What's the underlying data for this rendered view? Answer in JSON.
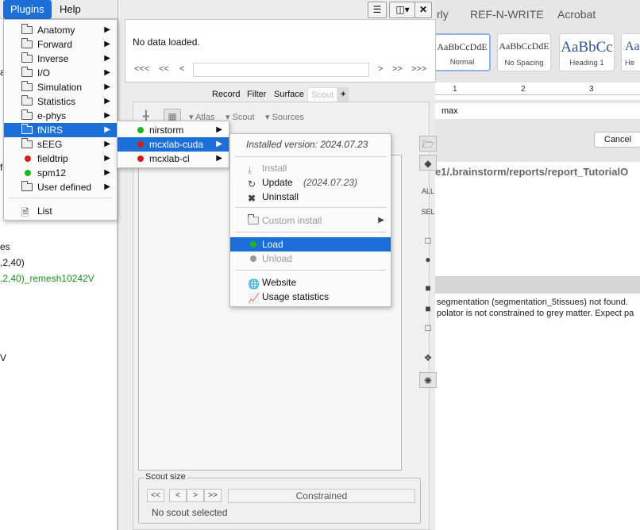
{
  "menubar": {
    "items": [
      {
        "label": "Plugins",
        "active": true
      },
      {
        "label": "Help",
        "active": false
      }
    ]
  },
  "plugins_menu": {
    "items": [
      {
        "label": "Anatomy",
        "submenu": true
      },
      {
        "label": "Forward",
        "submenu": true
      },
      {
        "label": "Inverse",
        "submenu": true
      },
      {
        "label": "I/O",
        "submenu": true
      },
      {
        "label": "Simulation",
        "submenu": true
      },
      {
        "label": "Statistics",
        "submenu": true
      },
      {
        "label": "e-phys",
        "submenu": true
      },
      {
        "label": "fNIRS",
        "submenu": true,
        "highlighted": true
      },
      {
        "label": "sEEG",
        "submenu": true
      },
      {
        "label": "fieldtrip",
        "submenu": true,
        "status": "red"
      },
      {
        "label": "spm12",
        "submenu": true,
        "status": "green"
      },
      {
        "label": "User defined",
        "submenu": true
      }
    ],
    "list_label": "List"
  },
  "fnirs_menu": {
    "items": [
      {
        "label": "nirstorm",
        "status": "green"
      },
      {
        "label": "mcxlab-cuda",
        "status": "red",
        "highlighted": true
      },
      {
        "label": "mcxlab-cl",
        "status": "red"
      }
    ]
  },
  "mcx_menu": {
    "installed_version": "Installed version: 2024.07.23",
    "install": "Install",
    "update": "Update",
    "update_version": "(2024.07.23)",
    "uninstall": "Uninstall",
    "custom_install": "Custom install",
    "load": "Load",
    "unload": "Unload",
    "website": "Website",
    "usage_statistics": "Usage statistics"
  },
  "panel": {
    "no_data": "No data loaded.",
    "nav": {
      "first": "<<<",
      "prev2": "<<",
      "prev": "<",
      "next": ">",
      "next2": ">>",
      "last": ">>>"
    },
    "tabs": [
      "Record",
      "Filter",
      "Surface",
      "Scout"
    ],
    "add_tab": "+",
    "scout_toolbar": {
      "atlas": "Atlas",
      "scout": "Scout",
      "sources": "Sources"
    },
    "side_labels": {
      "all": "ALL",
      "sel": "SEL"
    },
    "scout_size": {
      "legend": "Scout size",
      "buttons": [
        "<<",
        "<",
        ">",
        ">>"
      ],
      "constrained": "Constrained",
      "none_selected": "No scout selected"
    }
  },
  "left_fragments": {
    "a": "a",
    "fc": "fc",
    "es": "es",
    "coords": ",2,40)",
    "remesh": ",2,40)_remesh10242V",
    "v": "V"
  },
  "word": {
    "tabs": [
      "rly",
      "REF-N-WRITE",
      "Acrobat"
    ],
    "styles": [
      {
        "preview": "AaBbCcDdE",
        "name": "Normal"
      },
      {
        "preview": "AaBbCcDdE",
        "name": "No Spacing"
      },
      {
        "preview": "AaBbCc",
        "name": "Heading 1"
      },
      {
        "preview": "Aa",
        "name": "He"
      }
    ],
    "ruler_marks": [
      "1",
      "2",
      "3"
    ],
    "max_label": "max",
    "cancel": "Cancel",
    "path": "e1/.brainstorm/reports/report_TutorialO",
    "messages": [
      "segmentation (segmentation_5tissues) not found.",
      "polator is not constrained to grey matter. Expect pa"
    ]
  },
  "colors": {
    "accent": "#1c6fd6",
    "status_green": "#21b521",
    "status_red": "#d21d1d",
    "left_green_text": "#1a8f1a"
  }
}
